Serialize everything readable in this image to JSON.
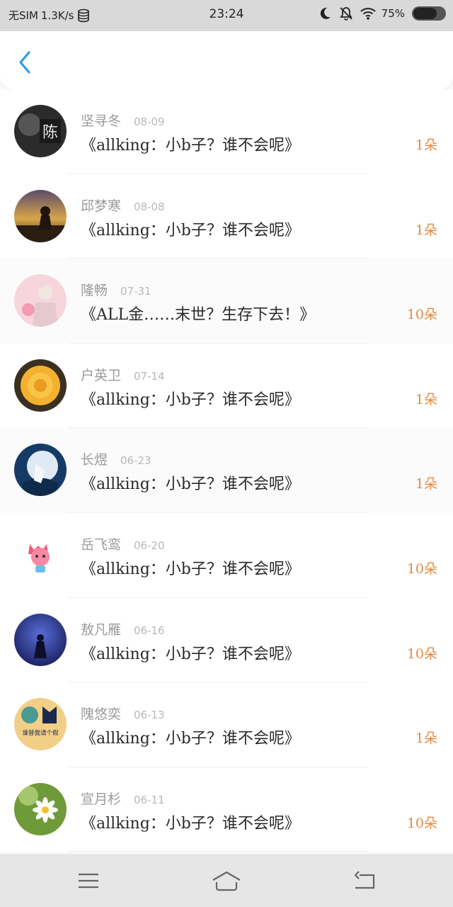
{
  "status_bar": {
    "carrier": "无SIM",
    "speed": "1.3K/s",
    "time": "23:24",
    "battery_percent": "75%",
    "battery_level": 0.75,
    "icons": [
      "database-icon",
      "moon-icon",
      "bell-off-icon",
      "wifi-icon",
      "battery-icon"
    ]
  },
  "header": {
    "back_icon": "chevron-left-icon",
    "accent_color": "#2f9be8"
  },
  "list": {
    "items": [
      {
        "name": "坚寻冬",
        "date": "08-09",
        "title": "《allking：小b子？谁不会呢》",
        "amount": "1朵"
      },
      {
        "name": "邱梦寒",
        "date": "08-08",
        "title": "《allking：小b子？谁不会呢》",
        "amount": "1朵"
      },
      {
        "name": "隆畅",
        "date": "07-31",
        "title": "《ALL金……末世？生存下去！》",
        "amount": "10朵"
      },
      {
        "name": "户英卫",
        "date": "07-14",
        "title": "《allking：小b子？谁不会呢》",
        "amount": "1朵"
      },
      {
        "name": "长煜",
        "date": "06-23",
        "title": "《allking：小b子？谁不会呢》",
        "amount": "1朵"
      },
      {
        "name": "岳飞鸾",
        "date": "06-20",
        "title": "《allking：小b子？谁不会呢》",
        "amount": "10朵"
      },
      {
        "name": "敖凡雁",
        "date": "06-16",
        "title": "《allking：小b子？谁不会呢》",
        "amount": "10朵"
      },
      {
        "name": "隗悠奕",
        "date": "06-13",
        "title": "《allking：小b子？谁不会呢》",
        "amount": "1朵"
      },
      {
        "name": "宣月杉",
        "date": "06-11",
        "title": "《allking：小b子？谁不会呢》",
        "amount": "10朵"
      }
    ],
    "avatar_glyph_1": "陈",
    "avatar_text_8": "谁替我请个假"
  },
  "nav_bar": {
    "icons": [
      "menu-icon",
      "home-icon",
      "back-icon"
    ]
  },
  "colors": {
    "amount": "#e58a3f",
    "name": "#9a9a9a",
    "date": "#b8b8b8",
    "title": "#2a2a2a",
    "accent": "#2f9be8"
  }
}
